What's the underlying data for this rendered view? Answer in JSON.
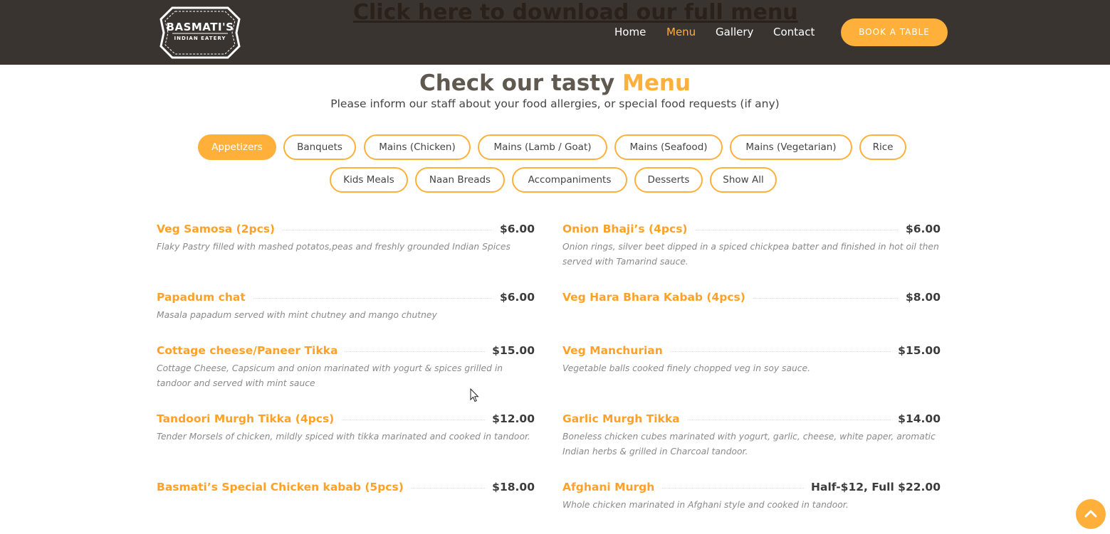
{
  "header": {
    "download_link": "Click here to download our full menu",
    "logo": {
      "name": "BASMATI'S",
      "tagline": "INDIAN EATERY"
    },
    "nav": [
      {
        "label": "Home",
        "active": false
      },
      {
        "label": "Menu",
        "active": true
      },
      {
        "label": "Gallery",
        "active": false
      },
      {
        "label": "Contact",
        "active": false
      }
    ],
    "book_button": "BOOK A TABLE"
  },
  "section": {
    "title_main": "Check our tasty",
    "title_accent": "Menu",
    "subtitle": "Please inform our staff about your food allergies, or special food requests (if any)"
  },
  "filters": [
    {
      "label": "Appetizers",
      "active": true
    },
    {
      "label": "Banquets",
      "active": false
    },
    {
      "label": "Mains (Chicken)",
      "active": false
    },
    {
      "label": "Mains (Lamb / Goat)",
      "active": false
    },
    {
      "label": "Mains (Seafood)",
      "active": false
    },
    {
      "label": "Mains (Vegetarian)",
      "active": false
    },
    {
      "label": "Rice",
      "active": false
    },
    {
      "label": "Kids Meals",
      "active": false
    },
    {
      "label": "Naan Breads",
      "active": false
    },
    {
      "label": "Accompaniments",
      "active": false
    },
    {
      "label": "Desserts",
      "active": false
    },
    {
      "label": "Show All",
      "active": false
    }
  ],
  "menu_items": [
    {
      "name": "Veg Samosa (2pcs)",
      "price": "$6.00",
      "description": "Flaky Pastry filled with mashed potatos,peas and freshly grounded Indian Spices"
    },
    {
      "name": "Onion Bhaji’s (4pcs)",
      "price": "$6.00",
      "description": "Onion rings, silver beet dipped in a spiced chickpea batter and finished in hot oil then served with Tamarind sauce."
    },
    {
      "name": "Papadum chat",
      "price": "$6.00",
      "description": "Masala papadum served with mint chutney and mango chutney"
    },
    {
      "name": "Veg Hara Bhara Kabab (4pcs)",
      "price": "$8.00",
      "description": ""
    },
    {
      "name": "Cottage cheese/Paneer Tikka",
      "price": "$15.00",
      "description": "Cottage Cheese, Capsicum and onion marinated with yogurt & spices grilled in tandoor and served with mint sauce"
    },
    {
      "name": "Veg Manchurian",
      "price": "$15.00",
      "description": "Vegetable balls cooked finely chopped veg in soy sauce."
    },
    {
      "name": "Tandoori Murgh Tikka (4pcs)",
      "price": "$12.00",
      "description": "Tender Morsels of chicken, mildly spiced with tikka marinated and cooked in tandoor."
    },
    {
      "name": "Garlic Murgh Tikka",
      "price": "$14.00",
      "description": "Boneless chicken cubes marinated with yogurt, garlic, cheese, white paper, aromatic Indian herbs & grilled in Charcoal tandoor."
    },
    {
      "name": "Basmati’s Special Chicken kabab (5pcs)",
      "price": "$18.00",
      "description": ""
    },
    {
      "name": "Afghani Murgh",
      "price": "Half-$12, Full $22.00",
      "description": "Whole chicken marinated in Afghani style and cooked in tandoor."
    }
  ],
  "colors": {
    "accent": "#ffb03b",
    "header_bg": "#3a3431",
    "item_name": "#ffa126"
  },
  "icons": {
    "back_to_top": "chevron-up-icon",
    "cursor": "mouse-pointer-icon"
  }
}
